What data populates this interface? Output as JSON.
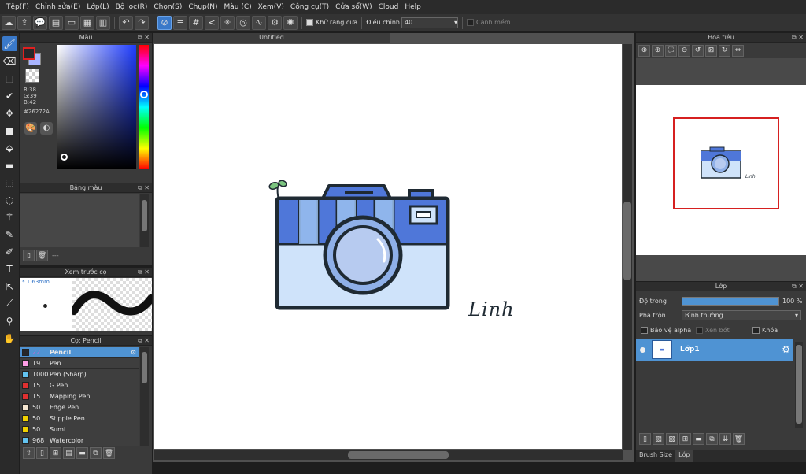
{
  "menu": [
    "Tệp(F)",
    "Chỉnh sửa(E)",
    "Lớp(L)",
    "Bộ lọc(R)",
    "Chọn(S)",
    "Chụp(N)",
    "Màu (C)",
    "Xem(V)",
    "Công cụ(T)",
    "Cửa sổ(W)",
    "Cloud",
    "Help"
  ],
  "toolbar": {
    "antialias_label": "Khử răng cưa",
    "adjust_label": "Điều chỉnh",
    "adjust_value": "40",
    "smooth_label": "Cạnh mềm"
  },
  "color_panel": {
    "title": "Màu",
    "r": "R:38",
    "g": "G:39",
    "b": "B:42",
    "hex": "#26272A",
    "fg_color": "#26272a",
    "bg_color": "#a9b4ff"
  },
  "palette_panel": {
    "title": "Bảng màu",
    "footer_text": "---"
  },
  "preview_panel": {
    "title": "Xem trước cọ",
    "size": "* 1.63mm"
  },
  "brush_panel": {
    "title": "Cọ: Pencil",
    "brushes": [
      {
        "size": "22",
        "name": "Pencil",
        "color": "#26272a"
      },
      {
        "size": "19",
        "name": "Pen",
        "color": "#ff9ee6"
      },
      {
        "size": "1000",
        "name": "Pen (Sharp)",
        "color": "#62c3f0"
      },
      {
        "size": "15",
        "name": "G Pen",
        "color": "#e03030"
      },
      {
        "size": "15",
        "name": "Mapping Pen",
        "color": "#e03030"
      },
      {
        "size": "50",
        "name": "Edge Pen",
        "color": "#f5e6d0"
      },
      {
        "size": "50",
        "name": "Stipple Pen",
        "color": "#f0d000"
      },
      {
        "size": "50",
        "name": "Sumi",
        "color": "#f0d000"
      },
      {
        "size": "968",
        "name": "Watercolor",
        "color": "#62c3f0"
      }
    ]
  },
  "canvas": {
    "tab_title": "Untitled",
    "signature": "Linh"
  },
  "navigator": {
    "title": "Hoa tiêu"
  },
  "layers": {
    "title": "Lớp",
    "opacity_label": "Độ trong",
    "opacity_value": "100 %",
    "blend_label": "Pha trộn",
    "blend_value": "Bình thường",
    "protect_alpha": "Bảo vệ alpha",
    "clipping": "Xén bớt",
    "lock": "Khóa",
    "layer_name": "Lớp1"
  },
  "bottom_tabs": [
    "Brush Size",
    "Lớp"
  ]
}
